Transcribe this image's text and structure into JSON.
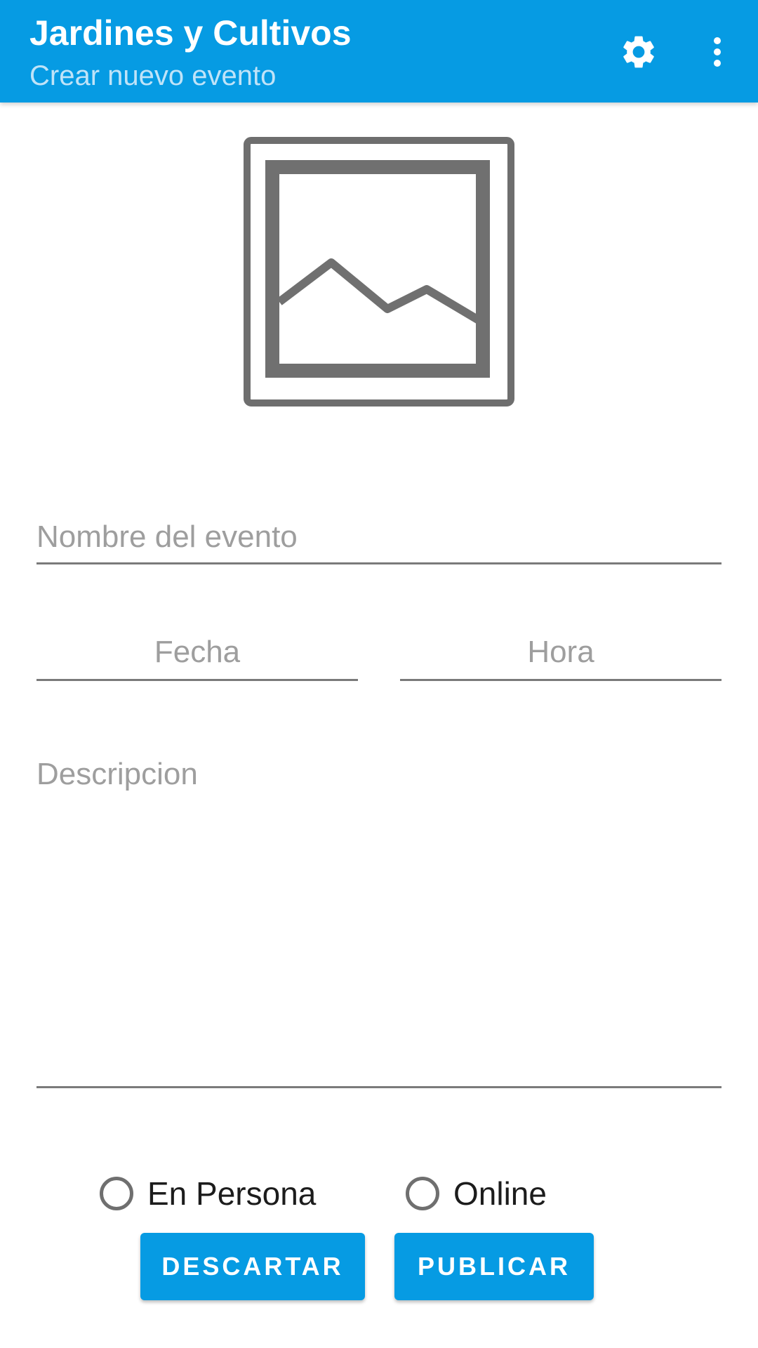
{
  "app_bar": {
    "title": "Jardines y Cultivos",
    "subtitle": "Crear nuevo evento",
    "background_color": "#069be3",
    "actions": [
      {
        "icon": "gear-icon"
      },
      {
        "icon": "more-vertical-icon"
      }
    ]
  },
  "image_picker": {
    "icon": "image-placeholder-icon"
  },
  "form": {
    "name_placeholder": "Nombre del evento",
    "date_placeholder": "Fecha",
    "time_placeholder": "Hora",
    "description_placeholder": "Descripcion",
    "modality_options": [
      {
        "label": "En Persona",
        "selected": false
      },
      {
        "label": "Online",
        "selected": false
      }
    ]
  },
  "buttons": {
    "discard_label": "DESCARTAR",
    "publish_label": "PUBLICAR",
    "color": "#069be3"
  }
}
